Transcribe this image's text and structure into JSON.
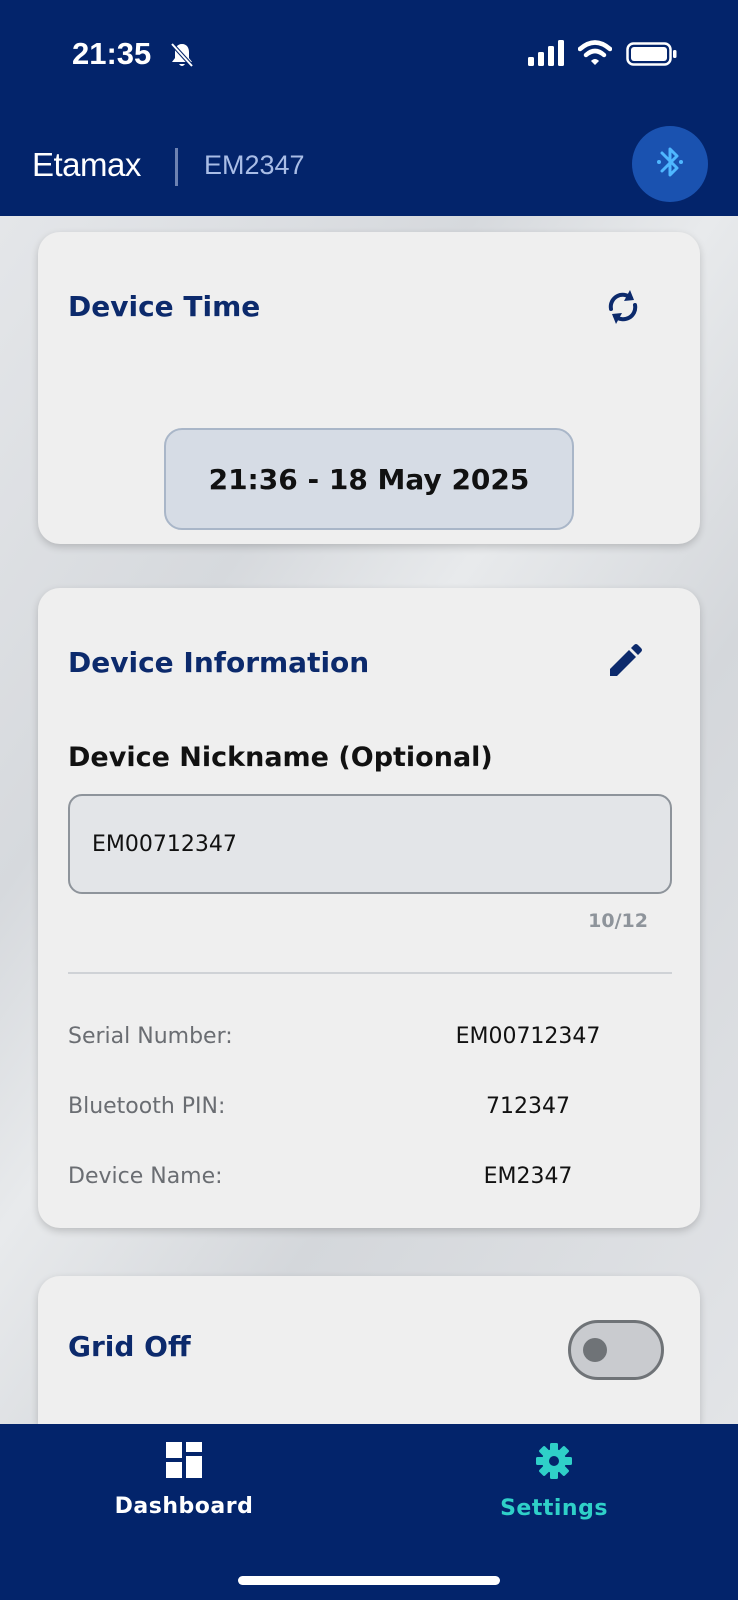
{
  "status_bar": {
    "time": "21:35",
    "icons": [
      "bell-slash-icon",
      "signal-icon",
      "wifi-icon",
      "battery-icon"
    ]
  },
  "header": {
    "brand": "Etamax",
    "device": "EM2347",
    "bluetooth_icon": "bluetooth-icon"
  },
  "device_time": {
    "title": "Device Time",
    "value": "21:36 - 18 May 2025",
    "sync_icon": "sync-icon"
  },
  "device_info": {
    "title": "Device Information",
    "edit_icon": "pencil-icon",
    "nickname_label": "Device Nickname (Optional)",
    "nickname_value": "EM00712347",
    "nickname_counter": "10/12",
    "rows": [
      {
        "label": "Serial Number:",
        "value": "EM00712347"
      },
      {
        "label": "Bluetooth PIN:",
        "value": "712347"
      },
      {
        "label": "Device Name:",
        "value": "EM2347"
      }
    ]
  },
  "grid": {
    "title": "Grid Off",
    "enabled": false
  },
  "nav": {
    "dashboard": "Dashboard",
    "settings": "Settings",
    "active": "settings"
  },
  "colors": {
    "primary": "#03246b",
    "accent": "#2fd0c8",
    "title": "#0c2a6c",
    "bluetooth": "#1a52b0"
  }
}
